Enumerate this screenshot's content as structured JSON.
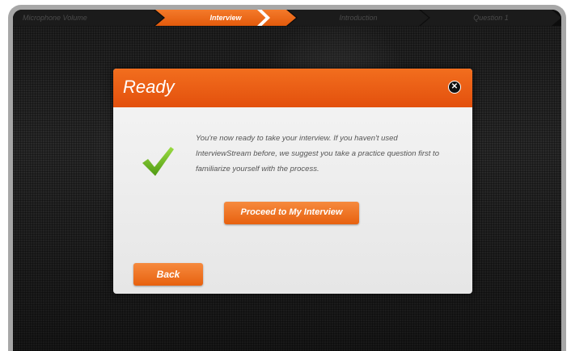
{
  "progress": {
    "steps": [
      {
        "label": "Microphone Volume",
        "active": false
      },
      {
        "label": "Interview",
        "active": true
      },
      {
        "label": "Introduction",
        "active": false
      },
      {
        "label": "Question 1",
        "active": false
      }
    ]
  },
  "dialog": {
    "title": "Ready",
    "close_icon": "close-icon",
    "status_icon": "checkmark-icon",
    "message": "You're now ready to take your interview. If you haven't used InterviewStream before, we suggest you take a practice question first to familiarize yourself with the process.",
    "proceed_label": "Proceed to My Interview",
    "back_label": "Back"
  },
  "colors": {
    "accent": "#e7610f",
    "check": "#7cc52c",
    "bezel": "#a7a7a7"
  }
}
